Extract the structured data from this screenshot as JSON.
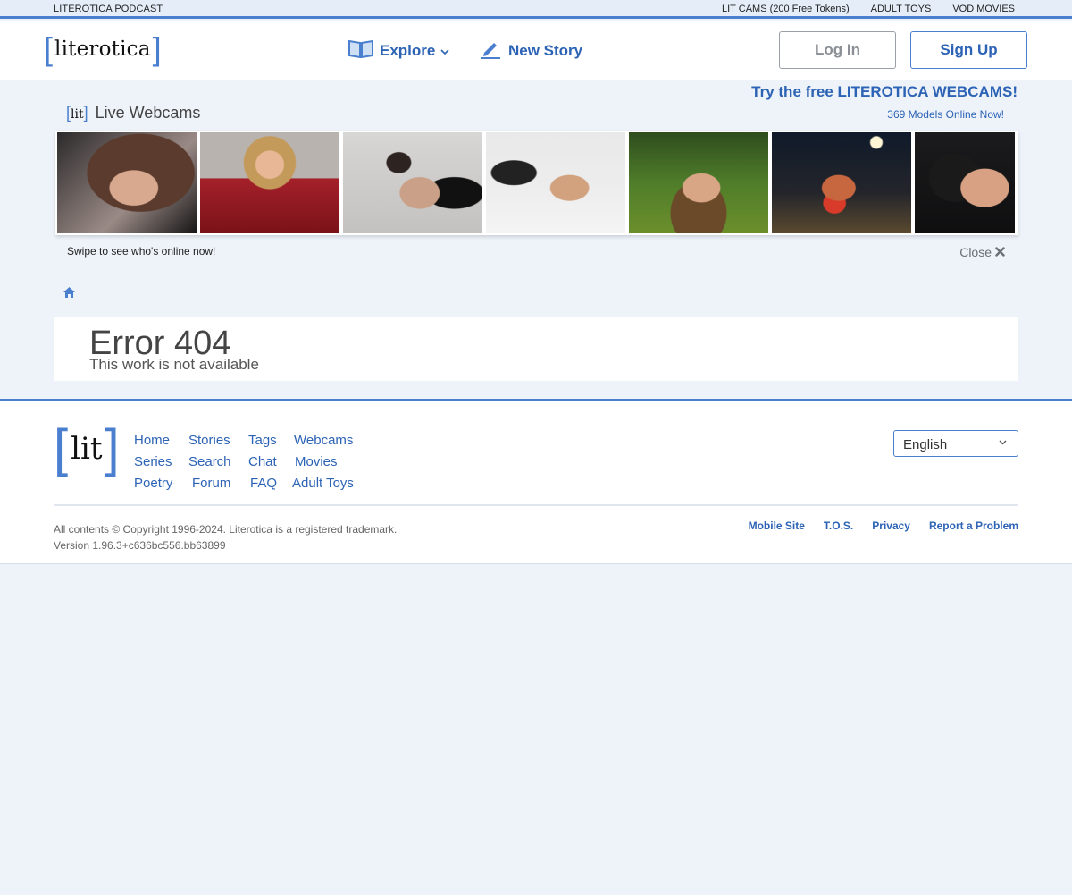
{
  "topbar": {
    "left_link": "LITEROTICA PODCAST",
    "right_links": [
      "LIT CAMS (200 Free Tokens)",
      "ADULT TOYS",
      "VOD MOVIES"
    ]
  },
  "header": {
    "logo": "literotica",
    "explore_label": "Explore",
    "new_story_label": "New Story",
    "login_label": "Log In",
    "signup_label": "Sign Up"
  },
  "webcams": {
    "mini_logo": "lit",
    "title": "Live Webcams",
    "promo": "Try the free LITEROTICA WEBCAMS!",
    "online": "369 Models Online Now!",
    "swipe": "Swipe to see who's online now!",
    "close": "Close"
  },
  "error": {
    "title": "Error 404",
    "subtitle": "This work is not available"
  },
  "footer": {
    "logo": "lit",
    "links": [
      [
        "Home",
        "Stories",
        "Tags",
        "Webcams"
      ],
      [
        "Series",
        "Search",
        "Chat",
        "Movies"
      ],
      [
        "Poetry",
        "Forum",
        "FAQ",
        "Adult Toys"
      ]
    ],
    "language": "English",
    "copyright": "All contents © Copyright 1996-2024. Literotica is a registered trademark.",
    "version": "Version 1.96.3+c636bc556.bb63899",
    "bottom_links": [
      "Mobile Site",
      "T.O.S.",
      "Privacy",
      "Report a Problem"
    ]
  },
  "colors": {
    "accent": "#4a7fcf",
    "link": "#2c63b5",
    "background": "#eef3fa"
  },
  "icons": [
    "explore-book-icon",
    "chevron-down-icon",
    "pencil-icon",
    "close-x-icon",
    "home-icon"
  ]
}
